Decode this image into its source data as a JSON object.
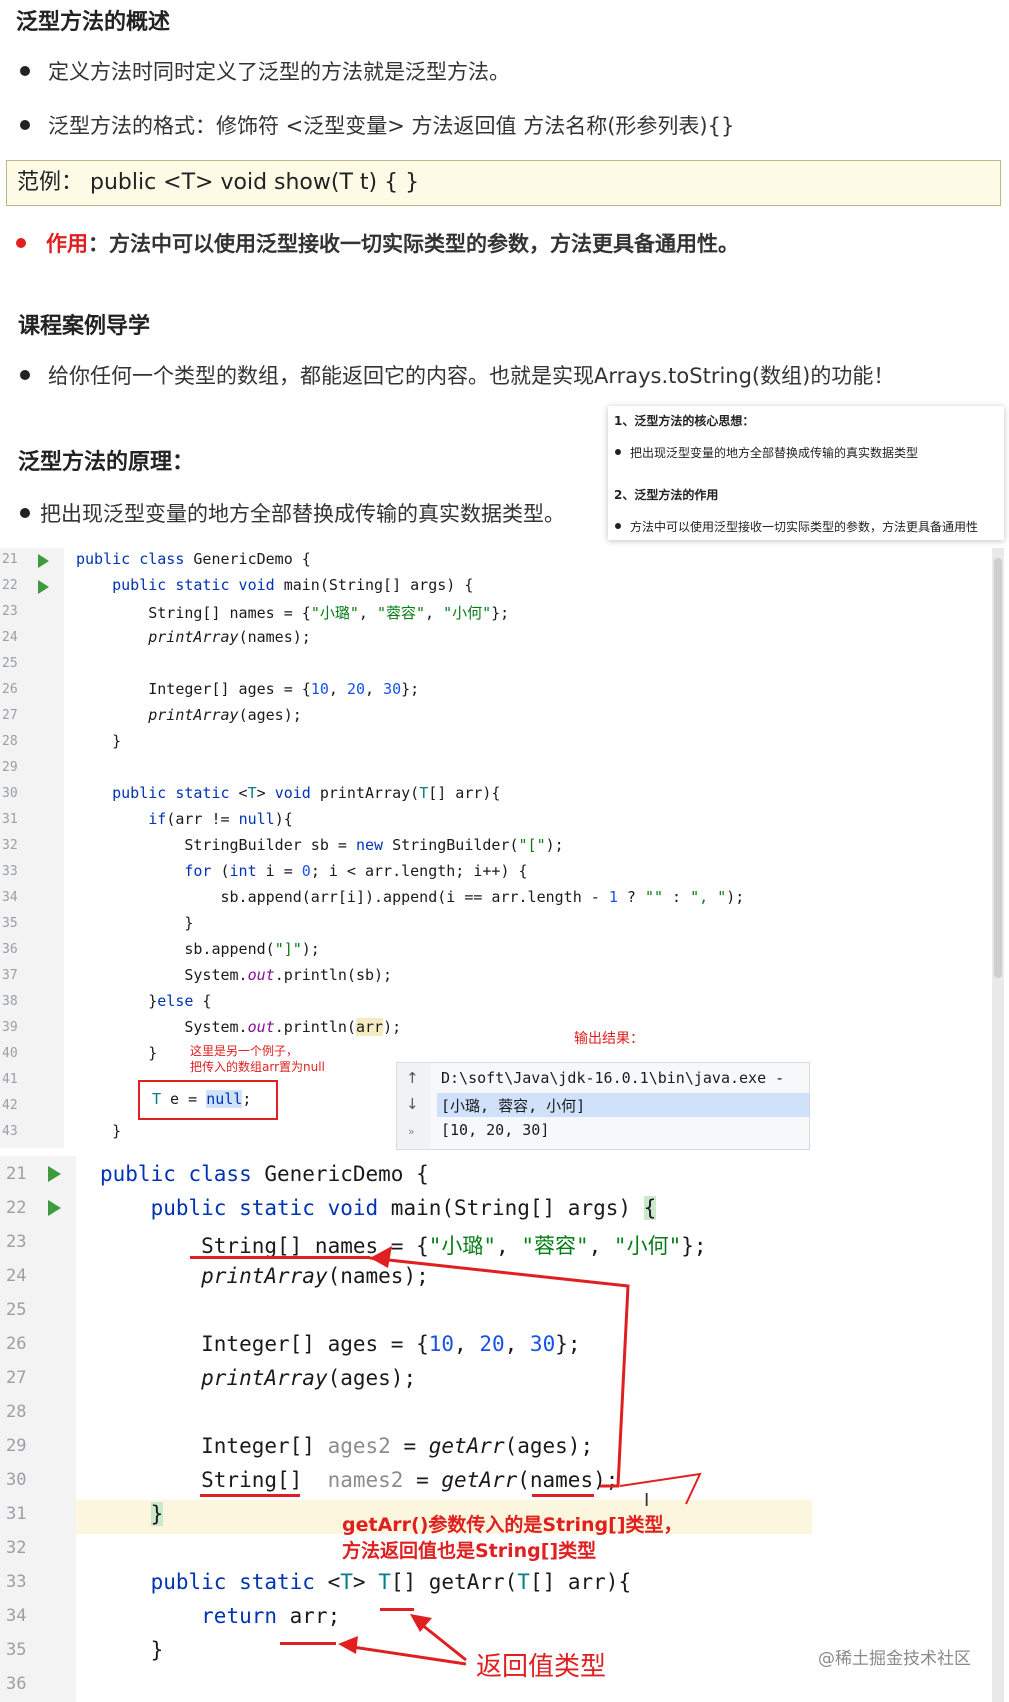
{
  "section1": {
    "title": "泛型方法的概述",
    "bullets": [
      "定义方法时同时定义了泛型的方法就是泛型方法。",
      "泛型方法的格式：修饰符 <泛型变量> 方法返回值 方法名称(形参列表){}"
    ],
    "example": "范例： public <T> void show(T t) { }",
    "effect_label": "作用",
    "effect_text": "：方法中可以使用泛型接收一切实际类型的参数，方法更具备通用性。"
  },
  "section2": {
    "title": "课程案例导学",
    "bullet": "给你任何一个类型的数组，都能返回它的内容。也就是实现Arrays.toString(数组)的功能！"
  },
  "section3": {
    "title": "泛型方法的原理：",
    "bullet": "把出现泛型变量的地方全部替换成传输的真实数据类型。"
  },
  "popup": {
    "t1": "1、泛型方法的核心思想：",
    "b1": "把出现泛型变量的地方全部替换成传输的真实数据类型",
    "t2": "2、泛型方法的作用",
    "b2": "方法中可以使用泛型接收一切实际类型的参数，方法更具备通用性"
  },
  "editor1": {
    "line_numbers": [
      "21",
      "22",
      "23",
      "24",
      "25",
      "26",
      "27",
      "28",
      "29",
      "30",
      "31",
      "32",
      "33",
      "34",
      "35",
      "36",
      "37",
      "38",
      "39",
      "40",
      "41",
      "42",
      "43"
    ],
    "note_line1": "这里是另一个例子，",
    "note_line2": "把传入的数组arr置为null",
    "output_label": "输出结果："
  },
  "console": {
    "cmd": "D:\\soft\\Java\\jdk-16.0.1\\bin\\java.exe -",
    "line1": "[小璐, 蓉容, 小何]",
    "line2": "[10, 20, 30]"
  },
  "editor2": {
    "line_numbers": [
      "21",
      "22",
      "23",
      "24",
      "25",
      "26",
      "27",
      "28",
      "29",
      "30",
      "31",
      "32",
      "33",
      "34",
      "35",
      "36"
    ],
    "annot1": "getArr()参数传入的是String[]类型，",
    "annot2": "方法返回值也是String[]类型",
    "annot3": "返回值类型"
  },
  "watermark": "@稀土掘金技术社区",
  "colors": {
    "accent_red": "#e02020",
    "keyword": "#0033b3",
    "string": "#067d17",
    "number": "#1750eb"
  }
}
